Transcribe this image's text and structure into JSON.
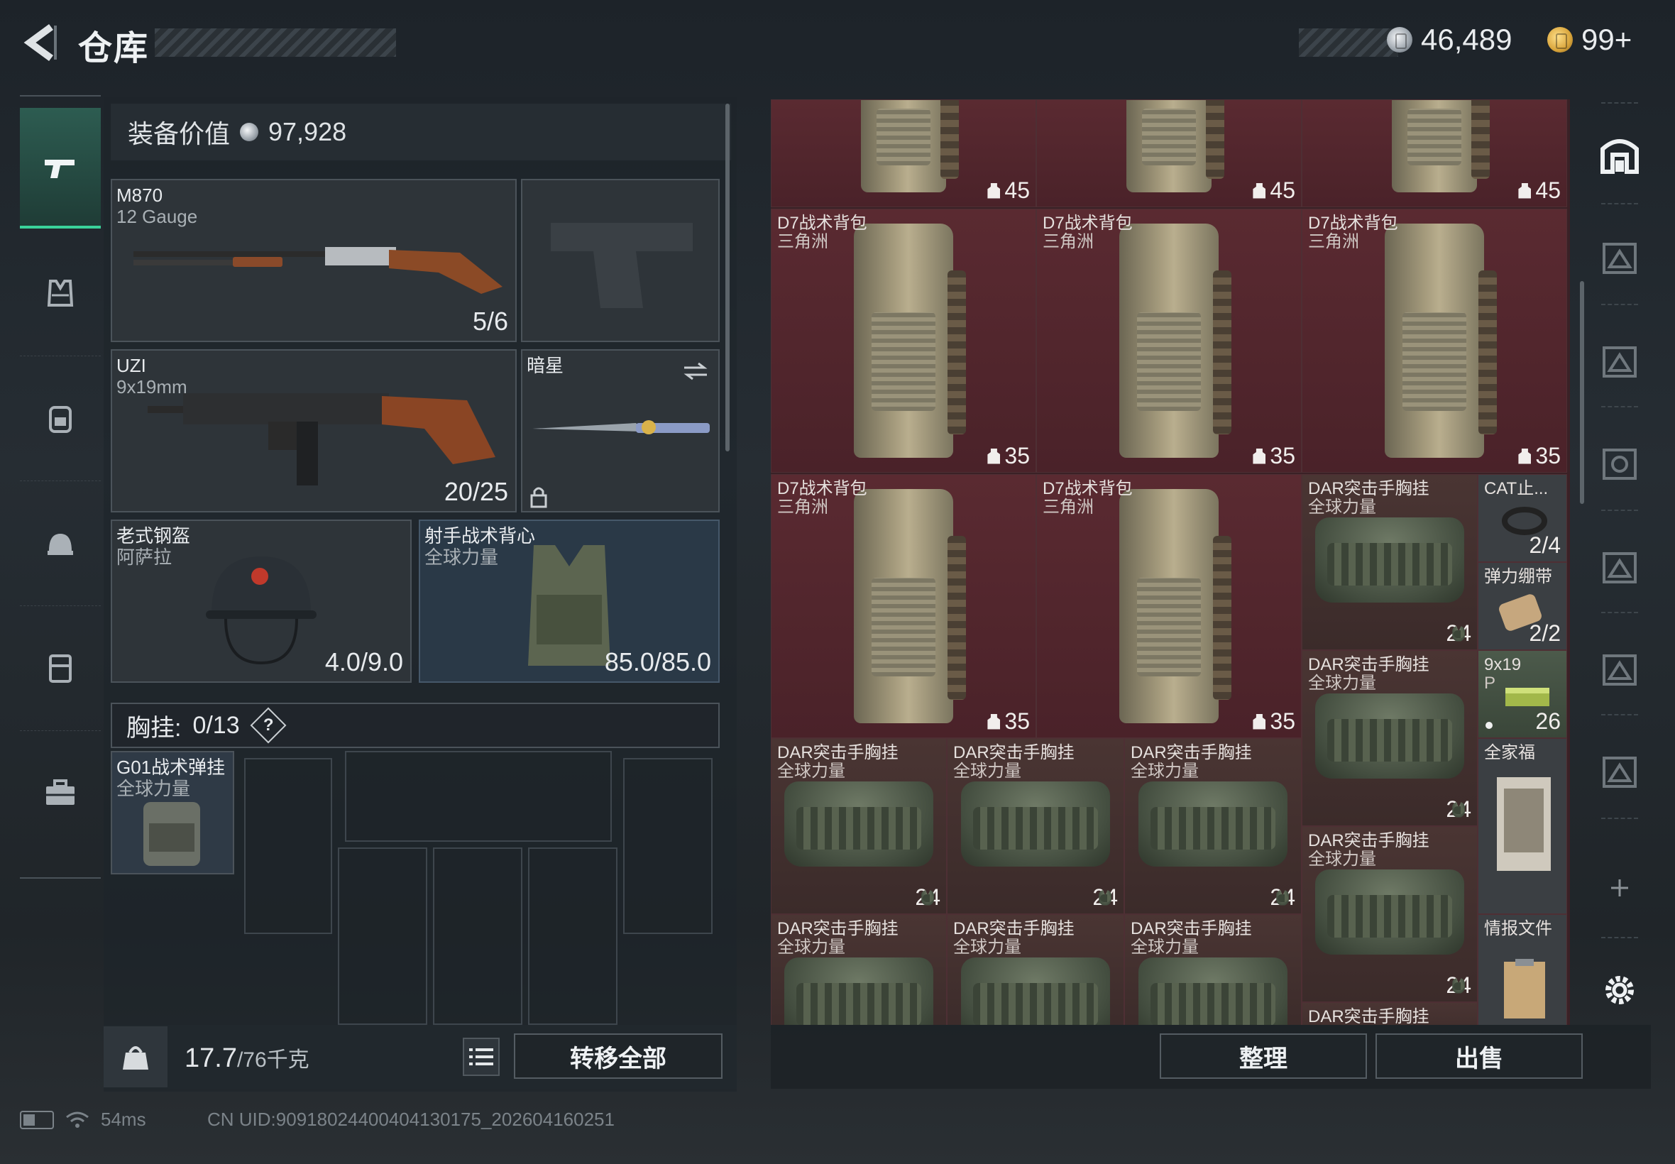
{
  "header": {
    "title": "仓库",
    "silver_amount": "46,489",
    "gold_amount": "99+"
  },
  "nav": {
    "items": [
      {
        "name": "weapons",
        "icon": "pistol-icon",
        "active": true
      },
      {
        "name": "armor",
        "icon": "vest-icon"
      },
      {
        "name": "backpack",
        "icon": "backpack-icon"
      },
      {
        "name": "helmet",
        "icon": "helmet-icon"
      },
      {
        "name": "chest-rig",
        "icon": "rig-icon"
      },
      {
        "name": "case",
        "icon": "briefcase-icon"
      }
    ]
  },
  "equipment": {
    "value_label": "装备价值",
    "value": "97,928",
    "primary": {
      "name": "M870",
      "sub": "12 Gauge",
      "count": "5/6"
    },
    "secondary": {
      "name": "UZI",
      "sub": "9x19mm",
      "count": "20/25"
    },
    "melee": {
      "name": "暗星"
    },
    "helmet": {
      "name": "老式钢盔",
      "sub": "阿萨拉",
      "count": "4.0/9.0"
    },
    "armor": {
      "name": "射手战术背心",
      "sub": "全球力量",
      "count": "85.0/85.0"
    },
    "chest": {
      "label": "胸挂:",
      "count": "0/13",
      "help": "?"
    },
    "chest_item": {
      "name": "G01战术弹挂",
      "sub": "全球力量"
    },
    "weight": {
      "current": "17.7",
      "max": "/76千克"
    },
    "transfer_all": "转移全部"
  },
  "stash": {
    "top_qty": [
      "45",
      "45",
      "45"
    ],
    "bags": [
      {
        "name": "D7战术背包",
        "sub": "三角洲",
        "qty": "35"
      },
      {
        "name": "D7战术背包",
        "sub": "三角洲",
        "qty": "35"
      },
      {
        "name": "D7战术背包",
        "sub": "三角洲",
        "qty": "35"
      },
      {
        "name": "D7战术背包",
        "sub": "三角洲",
        "qty": "35"
      },
      {
        "name": "D7战术背包",
        "sub": "三角洲",
        "qty": "35"
      }
    ],
    "rigs": [
      {
        "name": "DAR突击手胸挂",
        "sub": "全球力量",
        "qty": "24"
      },
      {
        "name": "DAR突击手胸挂",
        "sub": "全球力量",
        "qty": "24"
      },
      {
        "name": "DAR突击手胸挂",
        "sub": "全球力量",
        "qty": "24"
      },
      {
        "name": "DAR突击手胸挂",
        "sub": "全球力量",
        "qty": "24"
      },
      {
        "name": "DAR突击手胸挂",
        "sub": "全球力量",
        "qty": "24"
      },
      {
        "name": "DAR突击手胸挂",
        "sub": "全球力量",
        "qty": "24"
      },
      {
        "name": "DAR突击手胸挂",
        "sub": "全球力量"
      },
      {
        "name": "DAR突击手胸挂",
        "sub": "全球力量"
      },
      {
        "name": "DAR突击手胸挂",
        "sub": "全球力量"
      },
      {
        "name": "DAR突击手胸挂"
      }
    ],
    "small": [
      {
        "name": "CAT止...",
        "qty": "2/4"
      },
      {
        "name": "弹力绷带",
        "qty": "2/2"
      },
      {
        "name": "9x19",
        "sub": "P",
        "qty": "26"
      },
      {
        "name": "全家福"
      },
      {
        "name": "情报文件"
      }
    ],
    "sort_button": "整理",
    "sell_button": "出售"
  },
  "status": {
    "ping": "54ms",
    "uid": "CN UID:909180244004041​30175_202604160251"
  },
  "colors": {
    "accent_green": "#3ad29a",
    "stash_red": "#5a2a31",
    "stash_brown": "#4a3533"
  }
}
